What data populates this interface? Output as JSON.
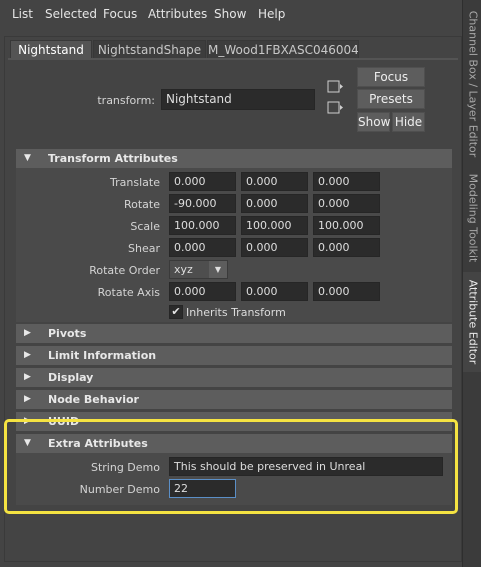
{
  "menubar": {
    "items": [
      "List",
      "Selected",
      "Focus",
      "Attributes",
      "Show",
      "Help"
    ]
  },
  "side_tabs": [
    "Channel Box / Layer Editor",
    "Modeling Toolkit",
    "Attribute Editor"
  ],
  "node_tabs": [
    "Nightstand",
    "NightstandShape",
    "M_Wood1FBXASC046004"
  ],
  "node": {
    "label": "transform:",
    "value": "Nightstand"
  },
  "buttons": {
    "focus": "Focus",
    "presets": "Presets",
    "show": "Show",
    "hide": "Hide"
  },
  "transform_section": {
    "title": "Transform Attributes",
    "rows": [
      {
        "label": "Translate",
        "values": [
          "0.000",
          "0.000",
          "0.000"
        ]
      },
      {
        "label": "Rotate",
        "values": [
          "-90.000",
          "0.000",
          "0.000"
        ]
      },
      {
        "label": "Scale",
        "values": [
          "100.000",
          "100.000",
          "100.000"
        ]
      },
      {
        "label": "Shear",
        "values": [
          "0.000",
          "0.000",
          "0.000"
        ]
      }
    ],
    "rotate_order": {
      "label": "Rotate Order",
      "value": "xyz"
    },
    "rotate_axis": {
      "label": "Rotate Axis",
      "values": [
        "0.000",
        "0.000",
        "0.000"
      ]
    },
    "inherits_transform": {
      "label": "Inherits Transform",
      "checked": true,
      "check_glyph": "✔"
    }
  },
  "collapsed_sections": [
    "Pivots",
    "Limit Information",
    "Display",
    "Node Behavior",
    "UUID"
  ],
  "extra_attributes": {
    "title": "Extra Attributes",
    "string_demo": {
      "label": "String Demo",
      "value": "This should be preserved in Unreal"
    },
    "number_demo": {
      "label": "Number Demo",
      "value": "22"
    }
  },
  "glyphs": {
    "expanded": "▼",
    "collapsed": "▶",
    "dropdown": "▼"
  },
  "colors": {
    "highlight": "#f5e342",
    "section": "#5d5d5d",
    "background": "#444444"
  }
}
